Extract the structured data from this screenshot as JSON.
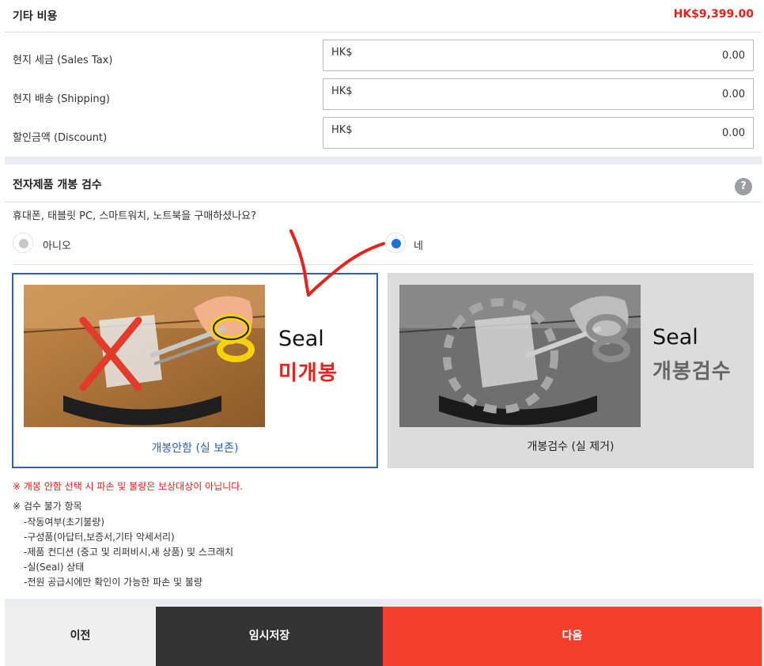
{
  "other_costs": {
    "title": "기타 비용",
    "total": "HK$9,399.00",
    "rows": [
      {
        "label": "현지 세금 (Sales Tax)",
        "currency": "HK$",
        "value": "0.00"
      },
      {
        "label": "현지 배송 (Shipping)",
        "currency": "HK$",
        "value": "0.00"
      },
      {
        "label": "할인금액 (Discount)",
        "currency": "HK$",
        "value": "0.00"
      }
    ]
  },
  "inspection": {
    "title": "전자제품 개봉 검수",
    "help": "?",
    "question": "휴대폰, 태블릿 PC, 스마트워치, 노트북을 구매하셨나요?",
    "options": {
      "no": "아니오",
      "yes": "네"
    },
    "selected": "yes",
    "cards": {
      "keep": {
        "seal_word": "Seal",
        "sub": "미개봉",
        "caption": "개봉안함 (실 보존)"
      },
      "open": {
        "seal_word": "Seal",
        "sub": "개봉검수",
        "caption": "개봉검수 (실 제거)"
      }
    },
    "warning": "※ 개봉 안함 선택 시 파손 및 불량은 보상대상이 아닙니다.",
    "notes_title": "※ 검수 불가 항목",
    "notes": [
      "-작동여부(초기불량)",
      "-구성품(아답터,보증서,기타 악세서리)",
      "-제품 컨디션 (중고 및 리퍼비시,새 상품) 및 스크래치",
      "-실(Seal) 상태",
      "-전원 공급시에만 확인이 가능한 파손 및 불량"
    ]
  },
  "buttons": {
    "prev": "이전",
    "temp_save": "임시저장",
    "next": "다음"
  },
  "colors": {
    "accent_red": "#e8221b",
    "selected_blue": "#2a63b4",
    "radio_blue": "#1a73d9",
    "next_button": "#f23e2b",
    "temp_button": "#333333"
  }
}
